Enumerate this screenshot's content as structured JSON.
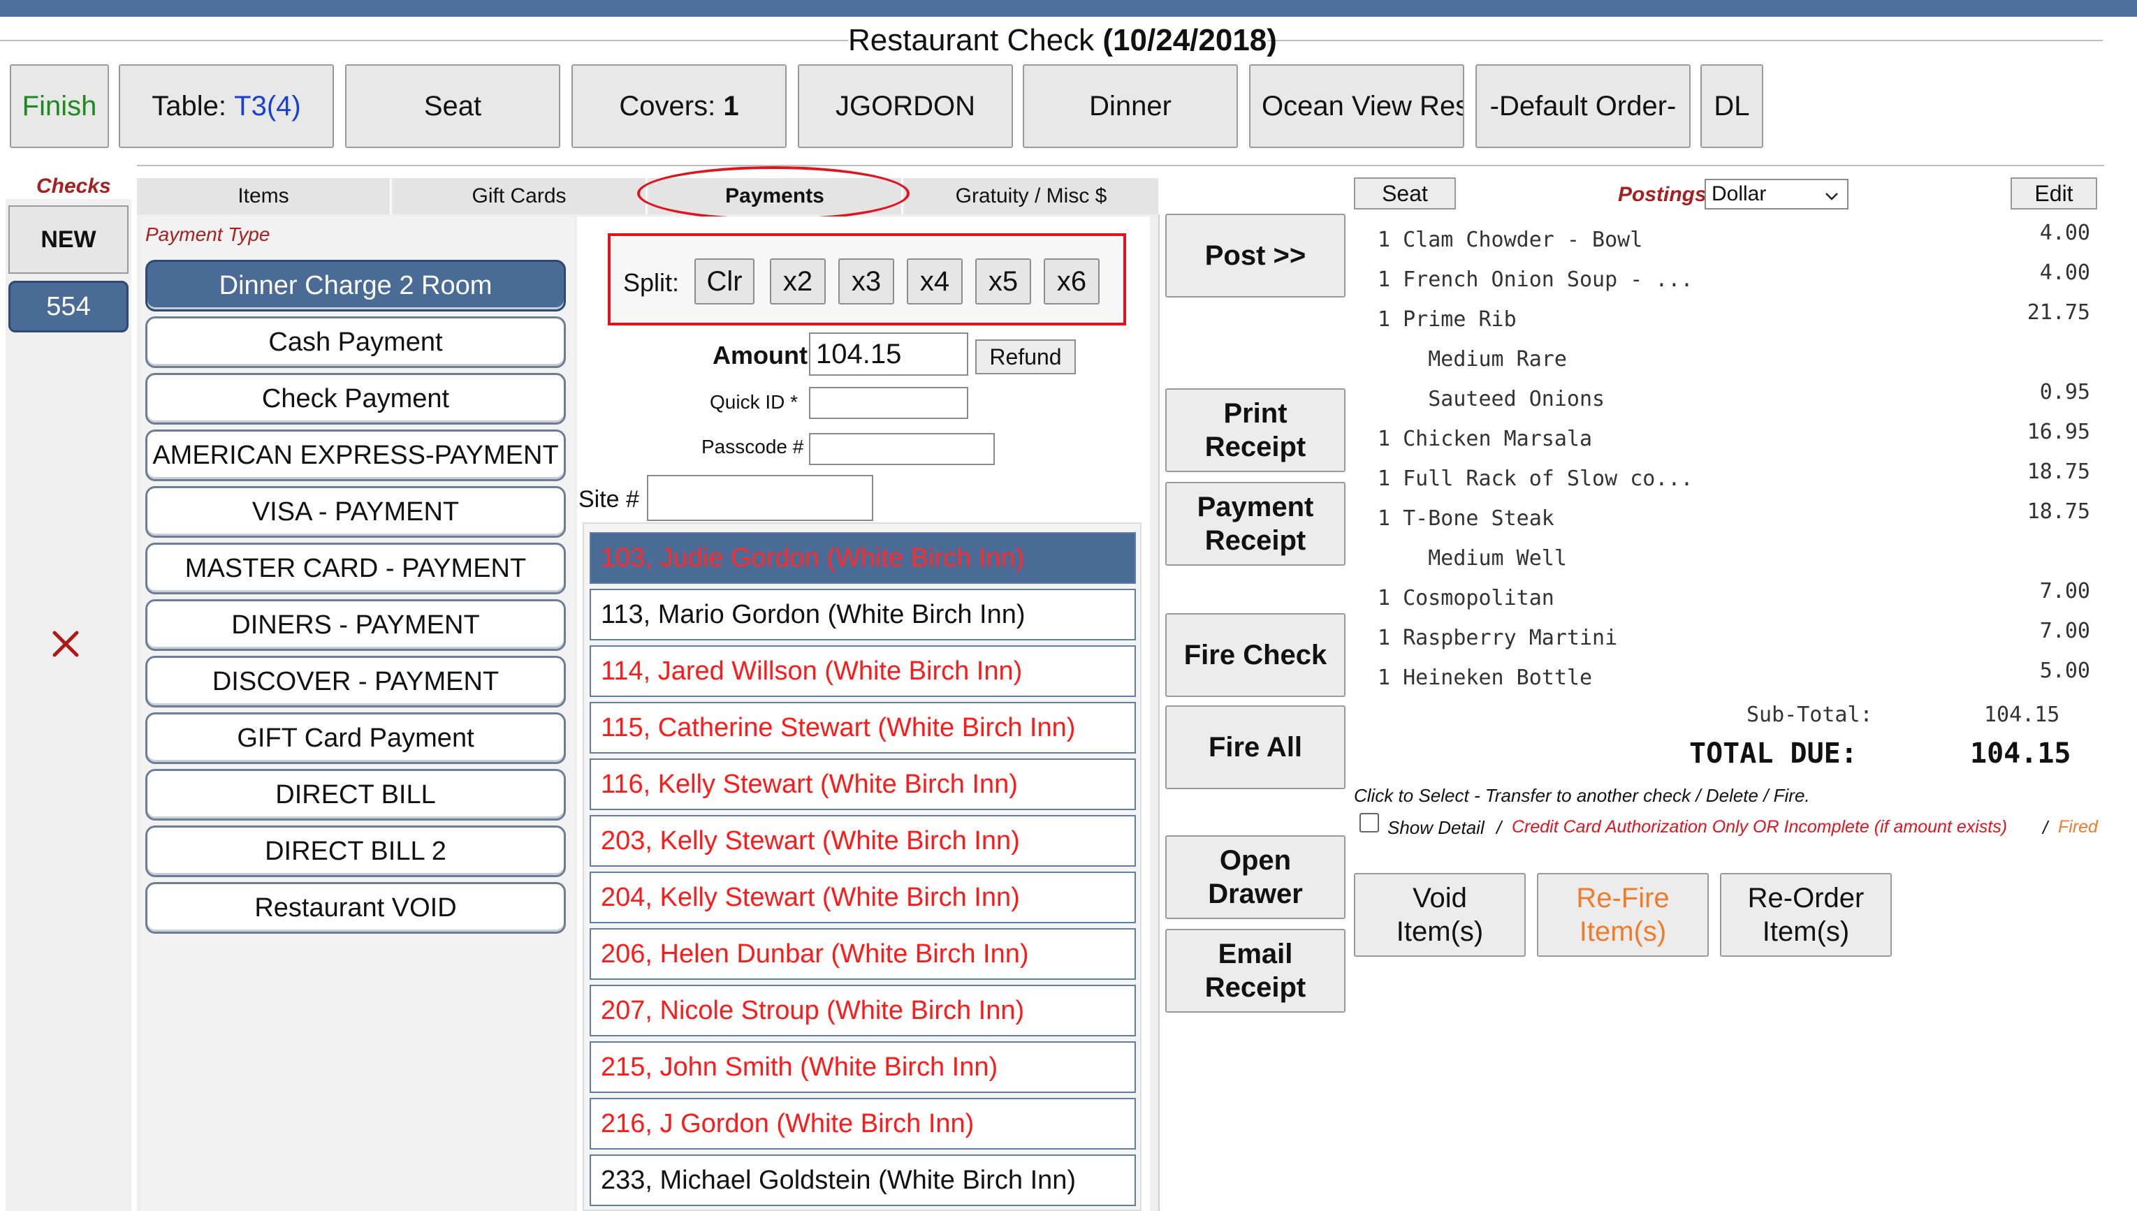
{
  "header": {
    "title": "Restaurant Check",
    "date": "(10/24/2018)"
  },
  "toolbar": {
    "finish": "Finish",
    "table_label": "Table:",
    "table_value": "T3(4)",
    "seat": "Seat",
    "covers_label": "Covers:",
    "covers_value": "1",
    "server": "JGORDON",
    "meal": "Dinner",
    "location": "Ocean View Resta",
    "order": "-Default Order-",
    "dl": "DL"
  },
  "checks": {
    "title": "Checks",
    "new": "NEW",
    "current": "554",
    "close_icon": "x-icon"
  },
  "tabs": [
    "Items",
    "Gift Cards",
    "Payments",
    "Gratuity / Misc $"
  ],
  "payment_type_label": "Payment Type",
  "payment_types": [
    "Dinner Charge 2 Room",
    "Cash Payment",
    "Check Payment",
    "AMERICAN EXPRESS-PAYMENT",
    "VISA - PAYMENT",
    "MASTER CARD - PAYMENT",
    "DINERS - PAYMENT",
    "DISCOVER - PAYMENT",
    "GIFT Card Payment",
    "DIRECT BILL",
    "DIRECT BILL 2",
    "Restaurant VOID"
  ],
  "split": {
    "label": "Split:",
    "buttons": [
      "Clr",
      "x2",
      "x3",
      "x4",
      "x5",
      "x6"
    ]
  },
  "amount": {
    "label": "Amount",
    "value": "104.15",
    "refund": "Refund"
  },
  "quick_id_label": "Quick ID *",
  "passcode_label": "Passcode #",
  "site_label": "Site #",
  "rooms": [
    "103, Judie Gordon (White Birch Inn)",
    "113, Mario Gordon (White Birch Inn)",
    "114, Jared Willson (White Birch Inn)",
    "115, Catherine Stewart (White Birch Inn)",
    "116, Kelly Stewart (White Birch Inn)",
    "203, Kelly Stewart (White Birch Inn)",
    "204, Kelly Stewart (White Birch Inn)",
    "206, Helen Dunbar (White Birch Inn)",
    "207, Nicole Stroup (White Birch Inn)",
    "215, John Smith (White Birch Inn)",
    "216, J Gordon (White Birch Inn)",
    "233, Michael Goldstein (White Birch Inn)"
  ],
  "actions": {
    "post": "Post >>",
    "print_receipt": [
      "Print",
      "Receipt"
    ],
    "payment_receipt": [
      "Payment",
      "Receipt"
    ],
    "fire_check": "Fire Check",
    "fire_all": "Fire All",
    "open_drawer": [
      "Open",
      "Drawer"
    ],
    "email_receipt": [
      "Email",
      "Receipt"
    ]
  },
  "order_header": {
    "seat": "Seat",
    "postings": "Postings",
    "currency": "Dollar",
    "edit": "Edit"
  },
  "order_lines": [
    {
      "text": "1 Clam Chowder - Bowl",
      "price": "4.00"
    },
    {
      "text": "1 French Onion Soup - ...",
      "price": "4.00"
    },
    {
      "text": "1 Prime Rib",
      "price": "21.75"
    },
    {
      "text": "    Medium Rare",
      "price": ""
    },
    {
      "text": "    Sauteed Onions",
      "price": "0.95"
    },
    {
      "text": "1 Chicken Marsala",
      "price": "16.95"
    },
    {
      "text": "1 Full Rack of Slow co...",
      "price": "18.75"
    },
    {
      "text": "1 T-Bone Steak",
      "price": "18.75"
    },
    {
      "text": "    Medium Well",
      "price": ""
    },
    {
      "text": "1 Cosmopolitan",
      "price": "7.00"
    },
    {
      "text": "1 Raspberry Martini",
      "price": "7.00"
    },
    {
      "text": "1 Heineken Bottle",
      "price": "5.00"
    }
  ],
  "totals": {
    "subtotal_label": "Sub-Total:",
    "subtotal": "104.15",
    "total_label": "TOTAL DUE:",
    "total": "104.15"
  },
  "hint": "Click to Select - Transfer to another check / Delete / Fire.",
  "show_detail": "Show Detail",
  "legend": {
    "sep1": "/",
    "cc_note": "Credit Card Authorization Only OR Incomplete (if amount exists)",
    "sep2": "/",
    "fired": "Fired"
  },
  "bottom_buttons": {
    "void": [
      "Void",
      "Item(s)"
    ],
    "refire": [
      "Re-Fire",
      "Item(s)"
    ],
    "reorder": [
      "Re-Order",
      "Item(s)"
    ]
  },
  "colors": {
    "accent_blue": "#4a6b95",
    "red_highlight": "#e0141e",
    "room_text_red": "#ff1a1a",
    "refire_orange": "#f07c2a",
    "fired_orange": "#f07c2a"
  }
}
